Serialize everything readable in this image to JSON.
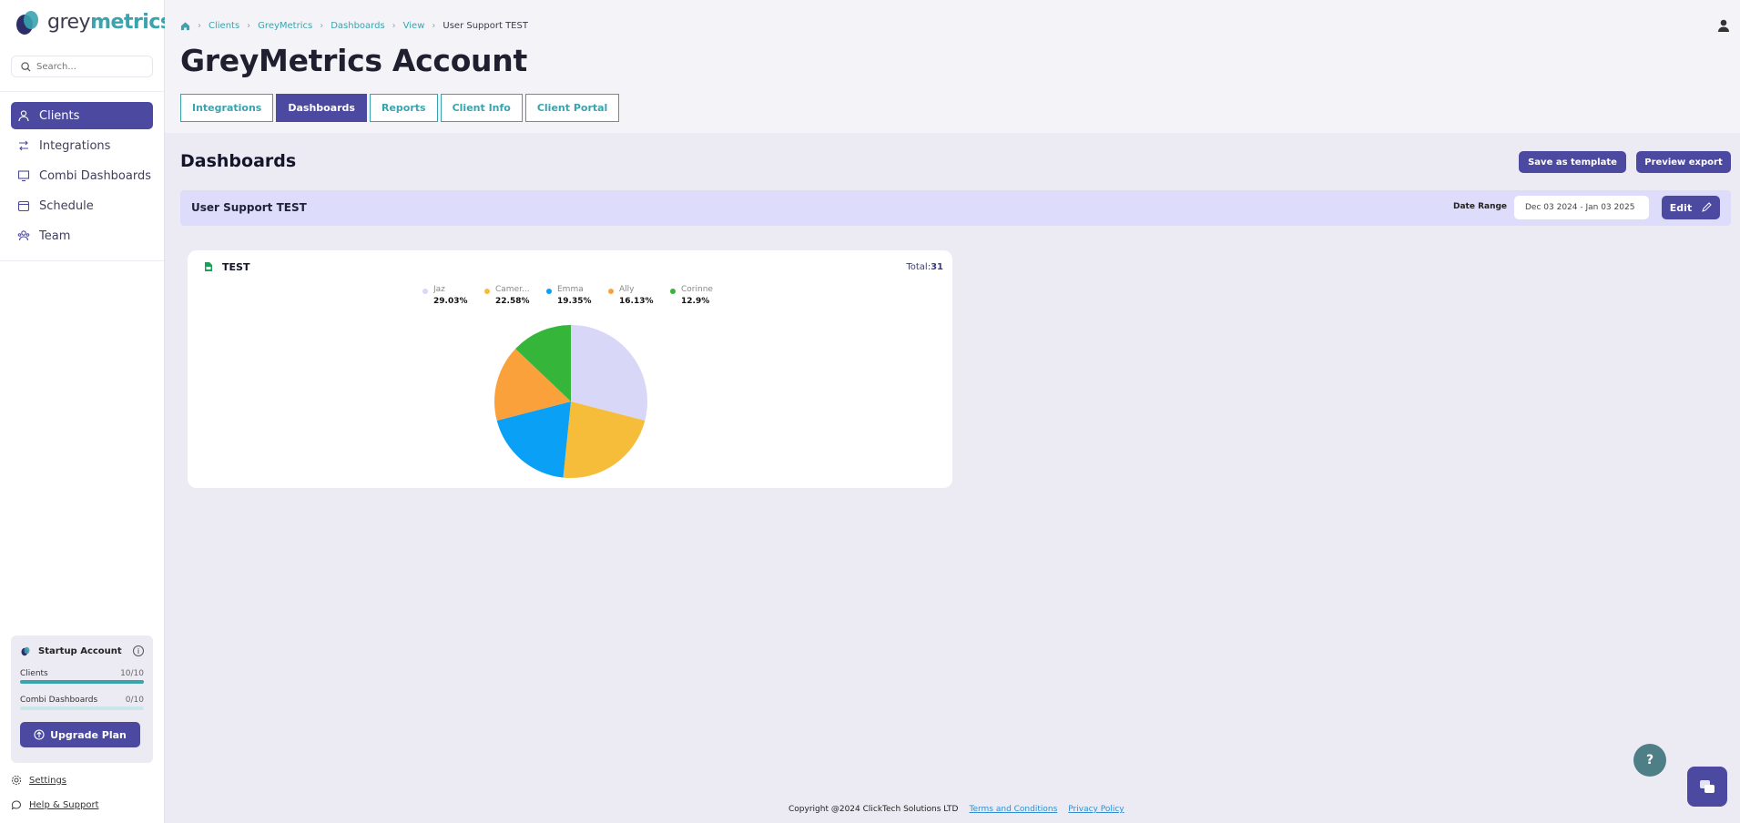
{
  "brand": {
    "logo_text_a": "grey",
    "logo_text_b": "metrics"
  },
  "search": {
    "placeholder": "Search..."
  },
  "nav": {
    "items": [
      {
        "label": "Clients",
        "icon": "user-icon",
        "active": true
      },
      {
        "label": "Integrations",
        "icon": "arrows-icon",
        "active": false
      },
      {
        "label": "Combi Dashboards",
        "icon": "monitor-icon",
        "active": false
      },
      {
        "label": "Schedule",
        "icon": "calendar-icon",
        "active": false
      },
      {
        "label": "Team",
        "icon": "team-icon",
        "active": false
      }
    ]
  },
  "plan": {
    "name": "Startup Account",
    "info_icon": "i",
    "meters": [
      {
        "label": "Clients",
        "count": "10/10",
        "fill": 1.0
      },
      {
        "label": "Combi Dashboards",
        "count": "0/10",
        "fill": 0.0
      }
    ],
    "upgrade_label": "Upgrade Plan"
  },
  "footer_links": {
    "settings": "Settings",
    "help": "Help & Support"
  },
  "breadcrumb": [
    "Clients",
    "GreyMetrics",
    "Dashboards",
    "View",
    "User Support TEST"
  ],
  "page_title": "GreyMetrics Account",
  "tabs": [
    {
      "label": "Integrations",
      "active": false
    },
    {
      "label": "Dashboards",
      "active": true
    },
    {
      "label": "Reports",
      "active": false
    },
    {
      "label": "Client Info",
      "active": false
    },
    {
      "label": "Client Portal",
      "active": false
    }
  ],
  "section": {
    "title": "Dashboards",
    "save_template_label": "Save as template",
    "preview_export_label": "Preview export"
  },
  "dashboard": {
    "name": "User Support TEST",
    "date_range_label": "Date Range",
    "date_range_value": "Dec 03 2024 - Jan 03 2025",
    "edit_label": "Edit"
  },
  "widget": {
    "title": "TEST",
    "total_label": "Total:",
    "total_value": "31"
  },
  "chart_data": {
    "type": "pie",
    "categories": [
      "Jaz",
      "Camer...",
      "Emma",
      "Ally",
      "Corinne"
    ],
    "percent_labels": [
      "29.03%",
      "22.58%",
      "19.35%",
      "16.13%",
      "12.9%"
    ],
    "values": [
      9,
      7,
      6,
      5,
      4
    ],
    "colors": [
      "#d9d7f7",
      "#f5bd3a",
      "#0aa0f5",
      "#fba13c",
      "#36b53b"
    ]
  },
  "copyright": {
    "text": "Copyright @2024 ClickTech Solutions LTD",
    "terms": "Terms and Conditions",
    "privacy": "Privacy Policy"
  },
  "help_fab": "?",
  "colors": {
    "primary": "#4c4aa0",
    "accent": "#3aa3ad",
    "band": "#dddcfa"
  }
}
